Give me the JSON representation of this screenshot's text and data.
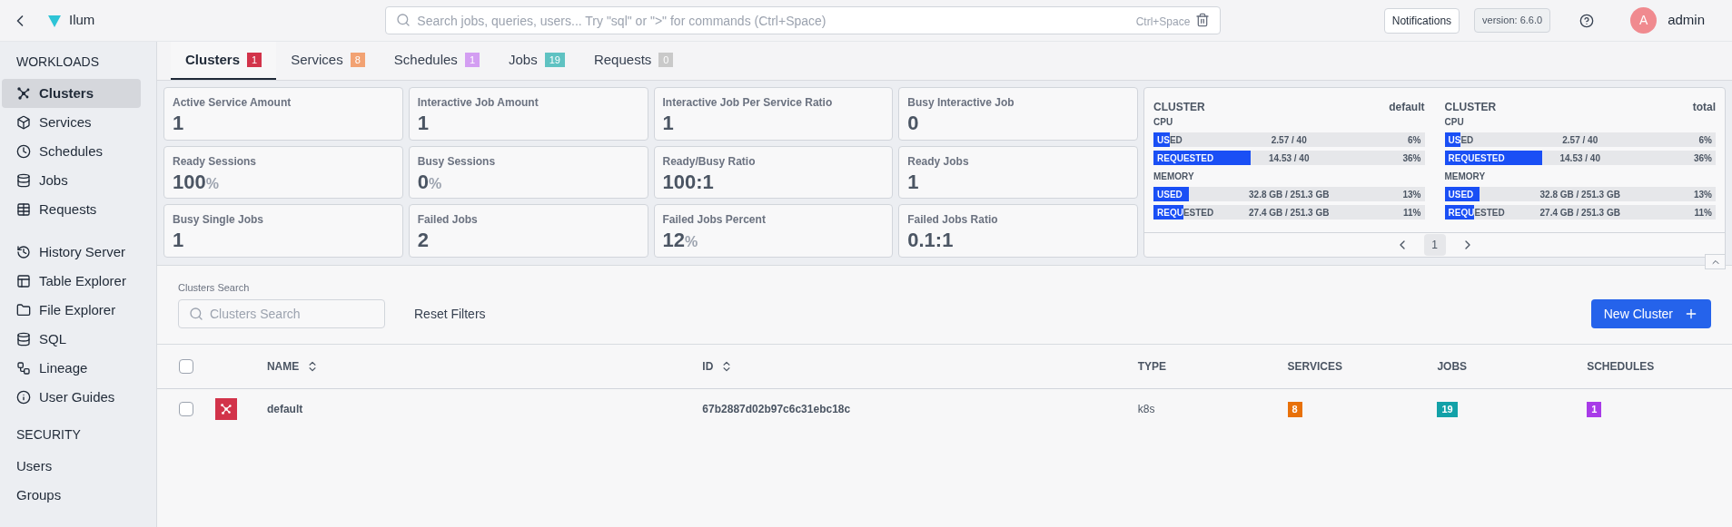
{
  "app": {
    "name": "Ilum"
  },
  "search": {
    "placeholder": "Search jobs, queries, users... Try \"sql\" or \">\" for commands (Ctrl+Space)",
    "shortcut": "Ctrl+Space"
  },
  "header": {
    "notifications": "Notifications",
    "version": "version: 6.6.0",
    "user": {
      "initial": "A",
      "name": "admin"
    }
  },
  "sidebar": {
    "sections": [
      {
        "title": "WORKLOADS",
        "items": [
          {
            "label": "Clusters",
            "selected": true
          },
          {
            "label": "Services",
            "selected": false
          },
          {
            "label": "Schedules",
            "selected": false
          },
          {
            "label": "Jobs",
            "selected": false
          },
          {
            "label": "Requests",
            "selected": false
          }
        ]
      },
      {
        "items": [
          {
            "label": "History Server",
            "selected": false
          },
          {
            "label": "Table Explorer",
            "selected": false
          },
          {
            "label": "File Explorer",
            "selected": false
          },
          {
            "label": "SQL",
            "selected": false
          },
          {
            "label": "Lineage",
            "selected": false
          },
          {
            "label": "User Guides",
            "selected": false
          }
        ]
      },
      {
        "title": "SECURITY",
        "items": [
          {
            "label": "Users",
            "selected": false
          },
          {
            "label": "Groups",
            "selected": false
          }
        ]
      }
    ]
  },
  "tabs": [
    {
      "label": "Clusters",
      "count": "1",
      "color": "#d2334a",
      "selected": true
    },
    {
      "label": "Services",
      "count": "8",
      "color": "#f2a273",
      "selected": false
    },
    {
      "label": "Schedules",
      "count": "1",
      "color": "#d39ef2",
      "selected": false
    },
    {
      "label": "Jobs",
      "count": "19",
      "color": "#5fc2c2",
      "selected": false
    },
    {
      "label": "Requests",
      "count": "0",
      "color": "#c9c9c9",
      "selected": false
    }
  ],
  "metrics": [
    {
      "label": "Active Service Amount",
      "value": "1"
    },
    {
      "label": "Interactive Job Amount",
      "value": "1"
    },
    {
      "label": "Interactive Job Per Service Ratio",
      "value": "1"
    },
    {
      "label": "Busy Interactive Job",
      "value": "0"
    },
    {
      "label": "Ready Sessions",
      "value": "100",
      "unit": "%"
    },
    {
      "label": "Busy Sessions",
      "value": "0",
      "unit": "%"
    },
    {
      "label": "Ready/Busy Ratio",
      "value": "100:1"
    },
    {
      "label": "Ready Jobs",
      "value": "1"
    },
    {
      "label": "Busy Single Jobs",
      "value": "1"
    },
    {
      "label": "Failed Jobs",
      "value": "2"
    },
    {
      "label": "Failed Jobs Percent",
      "value": "12",
      "unit": "%"
    },
    {
      "label": "Failed Jobs Ratio",
      "value": "0.1:1"
    }
  ],
  "resources": {
    "clusters": [
      {
        "title": "CLUSTER",
        "name": "default",
        "groups": [
          {
            "title": "CPU",
            "bars": [
              {
                "label": "USED",
                "reading": "2.57 / 40",
                "percent": "6%",
                "level": 0.06
              },
              {
                "label": "REQUESTED",
                "reading": "14.53 / 40",
                "percent": "36%",
                "level": 0.36
              }
            ]
          },
          {
            "title": "MEMORY",
            "bars": [
              {
                "label": "USED",
                "reading": "32.8 GB / 251.3 GB",
                "percent": "13%",
                "level": 0.13
              },
              {
                "label": "REQUESTED",
                "reading": "27.4 GB / 251.3 GB",
                "percent": "11%",
                "level": 0.11
              }
            ]
          }
        ]
      },
      {
        "title": "CLUSTER",
        "name": "total",
        "groups": [
          {
            "title": "CPU",
            "bars": [
              {
                "label": "USED",
                "reading": "2.57 / 40",
                "percent": "6%",
                "level": 0.06
              },
              {
                "label": "REQUESTED",
                "reading": "14.53 / 40",
                "percent": "36%",
                "level": 0.36
              }
            ]
          },
          {
            "title": "MEMORY",
            "bars": [
              {
                "label": "USED",
                "reading": "32.8 GB / 251.3 GB",
                "percent": "13%",
                "level": 0.13
              },
              {
                "label": "REQUESTED",
                "reading": "27.4 GB / 251.3 GB",
                "percent": "11%",
                "level": 0.11
              }
            ]
          }
        ]
      }
    ],
    "page": "1"
  },
  "filters": {
    "search_label": "Clusters Search",
    "search_placeholder": "Clusters Search",
    "reset": "Reset Filters",
    "new_button": "New Cluster"
  },
  "table": {
    "select_all_checked": false,
    "columns": [
      {
        "label": "NAME",
        "sortable": true
      },
      {
        "label": "ID",
        "sortable": true
      },
      {
        "label": "TYPE",
        "sortable": false
      },
      {
        "label": "SERVICES",
        "sortable": false
      },
      {
        "label": "JOBS",
        "sortable": false
      },
      {
        "label": "SCHEDULES",
        "sortable": false
      }
    ],
    "rows": [
      {
        "checked": false,
        "name": "default",
        "id": "67b2887d02b97c6c31ebc18c",
        "type": "k8s",
        "services": {
          "text": "8",
          "color": "#e8710a"
        },
        "jobs": {
          "text": "19",
          "color": "#13a1a8"
        },
        "schedules": {
          "text": "1",
          "color": "#a83be8"
        }
      }
    ]
  }
}
